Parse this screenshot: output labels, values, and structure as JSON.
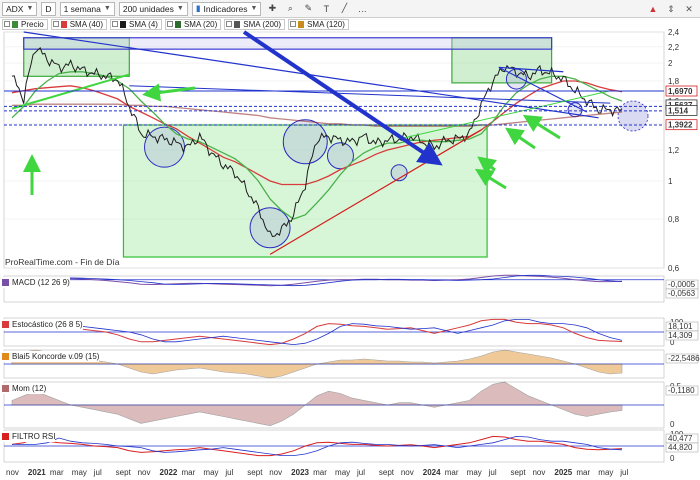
{
  "toolbar": {
    "symbol": "ADX",
    "period_letter": "D",
    "interval": "1 semana",
    "units": "200 unidades",
    "indicators_label": "Indicadores"
  },
  "main_legend": [
    {
      "label": "Precio",
      "color": "#3d8a3d"
    },
    {
      "label": "SMA (40)",
      "color": "#d83b3b"
    },
    {
      "label": "SMA (4)",
      "color": "#1a1a1a"
    },
    {
      "label": "SMA (20)",
      "color": "#2e6b2e"
    },
    {
      "label": "SMA (200)",
      "color": "#555555"
    },
    {
      "label": "SMA (120)",
      "color": "#c98a1e"
    }
  ],
  "source_label": "ProRealTime.com - Fin de Día",
  "axis": {
    "price_ticks": [
      "2,4",
      "2,2",
      "2",
      "1,8",
      "1,6",
      "1,4",
      "1,2",
      "1",
      "0,8",
      "0,6"
    ],
    "price_badges": [
      {
        "text": "1,6970",
        "color": "#d00000"
      },
      {
        "text": "1,5637",
        "color": "#1a1a1a"
      },
      {
        "text": "1,514",
        "color": "#1a1a1a"
      },
      {
        "text": "1,3922",
        "color": "#d00000"
      }
    ],
    "x_labels": [
      "nov",
      "2021",
      "mar",
      "may",
      "jul",
      "sept",
      "nov",
      "2022",
      "mar",
      "may",
      "jul",
      "sept",
      "nov",
      "2023",
      "mar",
      "may",
      "jul",
      "sept",
      "nov",
      "2024",
      "mar",
      "may",
      "jul",
      "sept",
      "nov",
      "2025",
      "mar",
      "may",
      "jul"
    ]
  },
  "chart_data": [
    {
      "type": "line",
      "title": "ADX",
      "series_name": "Precio",
      "y_scale": "log",
      "ylim": [
        0.6,
        2.4
      ],
      "x": [
        "2020-11",
        "2020-12",
        "2021-01",
        "2021-02",
        "2021-03",
        "2021-04",
        "2021-05",
        "2021-06",
        "2021-07",
        "2021-08",
        "2021-09",
        "2021-10",
        "2021-11",
        "2021-12",
        "2022-01",
        "2022-02",
        "2022-03",
        "2022-04",
        "2022-05",
        "2022-06",
        "2022-07",
        "2022-08",
        "2022-09",
        "2022-10",
        "2022-11",
        "2022-12",
        "2023-01",
        "2023-02",
        "2023-03",
        "2023-04",
        "2023-05",
        "2023-06",
        "2023-07",
        "2023-08",
        "2023-09",
        "2023-10",
        "2023-11",
        "2023-12",
        "2024-01",
        "2024-02",
        "2024-03",
        "2024-04",
        "2024-05",
        "2024-06",
        "2024-07",
        "2024-08",
        "2024-09",
        "2024-10",
        "2024-11",
        "2024-12",
        "2025-01",
        "2025-02",
        "2025-03"
      ],
      "values": [
        1.85,
        1.62,
        2.2,
        2.05,
        1.95,
        1.98,
        1.92,
        1.88,
        1.85,
        1.82,
        1.55,
        1.32,
        1.3,
        1.28,
        1.25,
        1.22,
        1.3,
        1.18,
        1.1,
        1.05,
        0.95,
        0.85,
        0.72,
        0.75,
        0.82,
        0.98,
        1.28,
        1.3,
        1.27,
        1.26,
        1.3,
        1.25,
        1.27,
        1.28,
        1.3,
        1.26,
        1.22,
        1.27,
        1.28,
        1.32,
        1.56,
        1.8,
        1.96,
        1.9,
        1.85,
        1.92,
        1.88,
        1.82,
        1.7,
        1.6,
        1.52,
        1.52,
        1.51
      ],
      "sma_40": [
        1.68,
        1.7,
        1.72,
        1.73,
        1.74,
        1.75,
        1.73,
        1.7,
        1.66,
        1.62,
        1.55,
        1.5,
        1.45,
        1.4,
        1.36,
        1.3,
        1.25,
        1.2,
        1.15,
        1.12,
        1.08,
        1.04,
        1.0,
        0.98,
        0.98,
        0.98,
        1.0,
        1.03,
        1.07,
        1.1,
        1.13,
        1.17,
        1.2,
        1.22,
        1.24,
        1.26,
        1.27,
        1.28,
        1.29,
        1.3,
        1.35,
        1.42,
        1.5,
        1.58,
        1.65,
        1.72,
        1.76,
        1.8,
        1.8,
        1.78,
        1.74,
        1.71,
        1.69
      ],
      "sma_20": [
        1.45,
        1.55,
        1.7,
        1.8,
        1.88,
        1.9,
        1.9,
        1.88,
        1.85,
        1.8,
        1.72,
        1.6,
        1.5,
        1.4,
        1.32,
        1.28,
        1.26,
        1.22,
        1.18,
        1.14,
        1.08,
        1.0,
        0.9,
        0.84,
        0.8,
        0.82,
        0.88,
        0.95,
        1.04,
        1.12,
        1.18,
        1.22,
        1.25,
        1.25,
        1.27,
        1.27,
        1.26,
        1.26,
        1.27,
        1.28,
        1.32,
        1.42,
        1.56,
        1.68,
        1.76,
        1.82,
        1.85,
        1.85,
        1.82,
        1.76,
        1.7,
        1.64,
        1.6
      ],
      "sma_200": [
        1.56,
        1.56,
        1.57,
        1.57,
        1.57,
        1.57,
        1.57,
        1.57,
        1.57,
        1.57,
        1.56,
        1.56,
        1.55,
        1.55,
        1.54,
        1.53,
        1.52,
        1.51,
        1.5,
        1.49,
        1.48,
        1.47,
        1.45,
        1.44,
        1.43,
        1.42,
        1.41,
        1.4,
        1.4,
        1.39,
        1.39,
        1.38,
        1.38,
        1.38,
        1.38,
        1.38,
        1.38,
        1.38,
        1.38,
        1.38,
        1.39,
        1.39,
        1.4,
        1.41,
        1.42,
        1.43,
        1.44,
        1.45,
        1.46,
        1.47,
        1.48,
        1.49,
        1.5
      ],
      "annotations": [
        "1,6970",
        "1,5637",
        "1,514",
        "1,3922"
      ]
    },
    {
      "type": "line",
      "title": "MACD (12 26 9)",
      "ylim": [
        -0.6,
        0.1
      ],
      "badges": [
        "-0,0005",
        "-0,0563"
      ],
      "values": [
        0.02,
        0.05,
        0.06,
        0.05,
        0.04,
        0.03,
        0.02,
        0.0,
        -0.02,
        -0.05,
        -0.08,
        -0.12,
        -0.13,
        -0.12,
        -0.11,
        -0.1,
        -0.1,
        -0.11,
        -0.12,
        -0.13,
        -0.14,
        -0.15,
        -0.16,
        -0.15,
        -0.12,
        -0.08,
        -0.04,
        -0.01,
        0.0,
        0.0,
        0.01,
        0.01,
        0.0,
        0.0,
        -0.01,
        -0.01,
        -0.02,
        -0.01,
        0.0,
        0.02,
        0.06,
        0.1,
        0.12,
        0.12,
        0.1,
        0.09,
        0.07,
        0.04,
        0.0,
        -0.03,
        -0.05,
        -0.05,
        -0.04
      ]
    },
    {
      "type": "line",
      "title": "Estocástico (26 8 5)",
      "ylim": [
        0,
        100
      ],
      "ticks": [
        "100",
        "0"
      ],
      "badges": [
        "18,101",
        "14,309"
      ],
      "values": [
        70,
        80,
        85,
        75,
        70,
        65,
        60,
        55,
        50,
        40,
        25,
        15,
        15,
        20,
        25,
        30,
        35,
        30,
        25,
        20,
        15,
        10,
        5,
        10,
        25,
        45,
        70,
        80,
        78,
        72,
        70,
        65,
        60,
        62,
        65,
        55,
        45,
        55,
        65,
        75,
        90,
        95,
        95,
        85,
        80,
        80,
        75,
        65,
        45,
        30,
        20,
        18,
        16
      ]
    },
    {
      "type": "area",
      "title": "Blai5 Koncorde v.09 (15)",
      "badges": [
        "-22,5486"
      ],
      "values": [
        10,
        12,
        14,
        12,
        10,
        8,
        6,
        4,
        2,
        0,
        -4,
        -8,
        -10,
        -8,
        -6,
        -5,
        -4,
        -6,
        -8,
        -9,
        -10,
        -12,
        -14,
        -12,
        -8,
        -4,
        0,
        2,
        4,
        4,
        5,
        4,
        3,
        3,
        2,
        2,
        1,
        2,
        3,
        5,
        8,
        12,
        14,
        12,
        10,
        8,
        6,
        3,
        0,
        -4,
        -8,
        -10,
        -9
      ]
    },
    {
      "type": "area",
      "title": "Mom (12)",
      "ylim": [
        -0.5,
        0.5
      ],
      "ticks": [
        "0,5",
        "0"
      ],
      "badges": [
        "-0,1180"
      ],
      "values": [
        0.1,
        0.2,
        0.3,
        0.2,
        0.1,
        0.0,
        -0.05,
        -0.1,
        -0.15,
        -0.2,
        -0.3,
        -0.4,
        -0.35,
        -0.3,
        -0.25,
        -0.2,
        -0.15,
        -0.2,
        -0.25,
        -0.3,
        -0.35,
        -0.4,
        -0.45,
        -0.35,
        -0.2,
        0.0,
        0.2,
        0.3,
        0.25,
        0.15,
        0.1,
        0.05,
        0.0,
        0.05,
        0.05,
        0.0,
        -0.05,
        0.0,
        0.05,
        0.1,
        0.3,
        0.45,
        0.5,
        0.35,
        0.2,
        0.1,
        0.0,
        -0.1,
        -0.2,
        -0.25,
        -0.2,
        -0.15,
        -0.12
      ]
    },
    {
      "type": "line",
      "title": "FILTRO RSI",
      "ylim": [
        0,
        100
      ],
      "ticks": [
        "100",
        "0"
      ],
      "badges": [
        "40,477",
        "44,820"
      ],
      "values": [
        55,
        60,
        75,
        65,
        60,
        58,
        55,
        50,
        48,
        45,
        35,
        30,
        32,
        35,
        38,
        40,
        45,
        40,
        35,
        30,
        25,
        20,
        20,
        25,
        35,
        50,
        60,
        62,
        58,
        55,
        55,
        52,
        50,
        52,
        54,
        50,
        45,
        50,
        55,
        60,
        70,
        80,
        78,
        70,
        65,
        65,
        60,
        55,
        45,
        40,
        38,
        40,
        42
      ]
    }
  ]
}
